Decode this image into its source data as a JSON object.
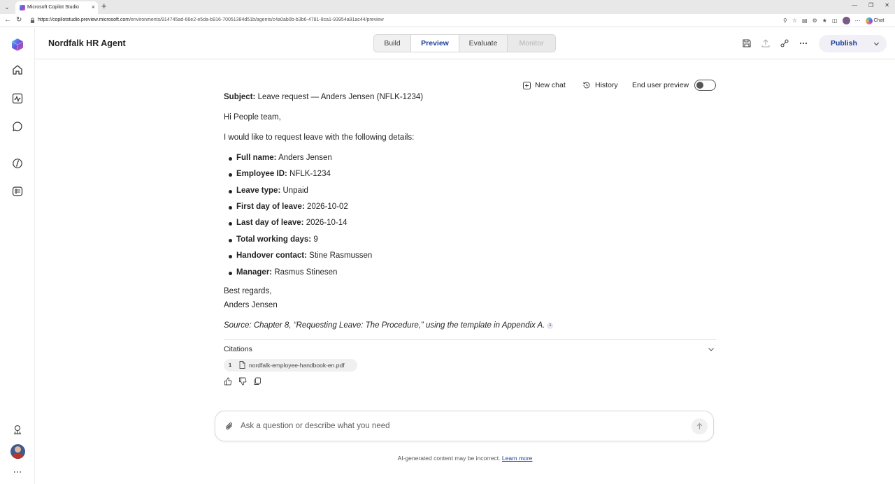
{
  "browser": {
    "tab_title": "Microsoft Copilot Studio",
    "url_host": "https://copilotstudio.preview.microsoft.com",
    "url_path": "/environments/914745ad-66e2-e5da-b916-70051384d51b/agents/c4a0ab0b-b3b6-4781-8ca1-93954a91ac44/preview",
    "chat_label": "Chat"
  },
  "header": {
    "agent_name": "Nordfalk HR Agent",
    "tabs": [
      {
        "label": "Build"
      },
      {
        "label": "Preview"
      },
      {
        "label": "Evaluate"
      },
      {
        "label": "Monitor"
      }
    ],
    "publish_label": "Publish"
  },
  "toolbar": {
    "new_chat": "New chat",
    "history": "History",
    "end_user_preview": "End user preview"
  },
  "message": {
    "subject_label": "Subject:",
    "subject_value": " Leave request — Anders Jensen (NFLK-1234)",
    "greeting": "Hi People team,",
    "intro": "I would like to request leave with the following details:",
    "details": [
      {
        "label": "Full name:",
        "value": " Anders Jensen"
      },
      {
        "label": "Employee ID:",
        "value": " NFLK-1234"
      },
      {
        "label": "Leave type:",
        "value": " Unpaid"
      },
      {
        "label": "First day of leave:",
        "value": " 2026-10-02"
      },
      {
        "label": "Last day of leave:",
        "value": " 2026-10-14"
      },
      {
        "label": "Total working days:",
        "value": " 9"
      },
      {
        "label": "Handover contact:",
        "value": " Stine Rasmussen"
      },
      {
        "label": "Manager:",
        "value": " Rasmus Stinesen"
      }
    ],
    "closing": "Best regards,",
    "signature": "Anders Jensen",
    "source": "Source: Chapter 8, “Requesting Leave: The Procedure,” using the template in Appendix A.",
    "source_citation_num": "1"
  },
  "citations": {
    "title": "Citations",
    "items": [
      {
        "num": "1",
        "name": "nordfalk-employee-handbook-en.pdf"
      }
    ]
  },
  "input": {
    "placeholder": "Ask a question or describe what you need",
    "value": ""
  },
  "footer": {
    "disclaimer": "AI-generated content may be incorrect.",
    "learn_more": "Learn more"
  }
}
